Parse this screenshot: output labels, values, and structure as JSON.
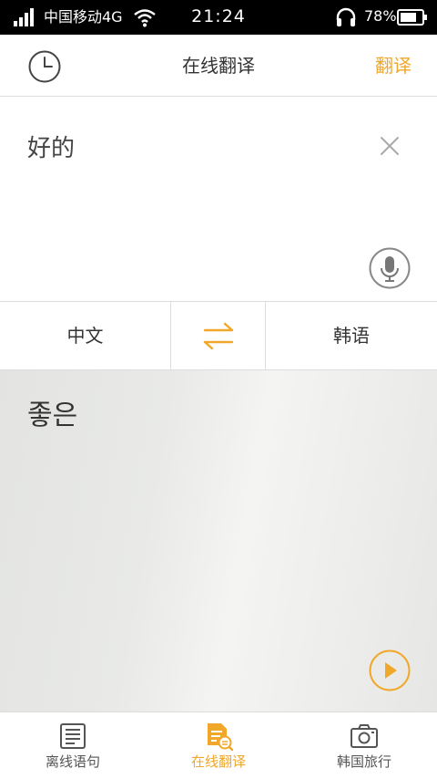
{
  "status_bar": {
    "carrier": "中国移动4G",
    "time": "21:24",
    "battery_percent": "78%"
  },
  "header": {
    "title": "在线翻译",
    "translate_label": "翻译",
    "history_icon": "clock-icon"
  },
  "input": {
    "text": "好的",
    "clear_icon": "close-icon",
    "mic_icon": "microphone-icon"
  },
  "languages": {
    "source": "中文",
    "target": "韩语",
    "swap_icon": "swap-arrows-icon"
  },
  "result": {
    "text": "좋은",
    "play_icon": "play-icon"
  },
  "bottom_nav": {
    "items": [
      {
        "label": "离线语句",
        "icon": "phrasebook-icon",
        "active": false
      },
      {
        "label": "在线翻译",
        "icon": "translate-document-icon",
        "active": true
      },
      {
        "label": "韩国旅行",
        "icon": "camera-icon",
        "active": false
      }
    ]
  },
  "colors": {
    "accent": "#f0a72a",
    "status_bar_bg": "#000000",
    "divider": "#dcdcdc"
  }
}
